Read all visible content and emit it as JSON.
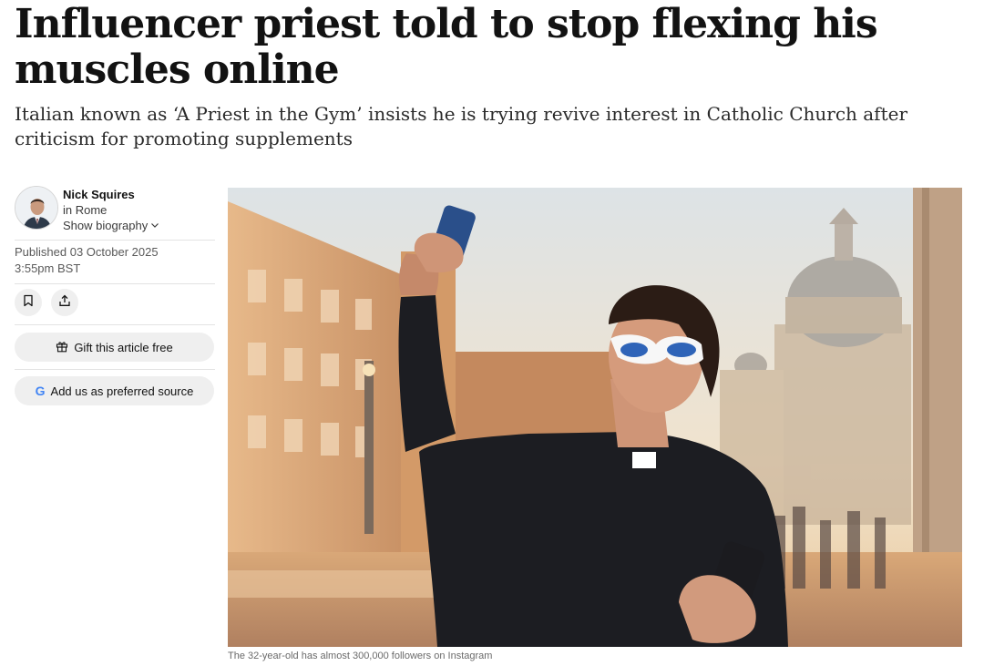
{
  "article": {
    "headline": "Influencer priest told to stop flexing his muscles online",
    "standfirst": "Italian known as ‘A Priest in the Gym’ insists he is trying revive interest in Catholic Church after criticism for promoting supplements"
  },
  "author": {
    "name": "Nick Squires",
    "location": "in Rome",
    "bio_toggle": "Show biography"
  },
  "published": {
    "date": "Published 03 October 2025",
    "time": "3:55pm BST"
  },
  "actions": {
    "gift_label": "Gift this article free",
    "preferred_source_label": "Add us as preferred source",
    "google_letter": "G"
  },
  "image": {
    "caption": "The 32-year-old has almost 300,000 followers on Instagram"
  },
  "icons": [
    "bookmark-icon",
    "share-icon",
    "gift-icon",
    "google-icon",
    "chevron-down-icon"
  ],
  "colors": {
    "text": "#121212",
    "muted": "#5a5a5a",
    "pill_bg": "#efefef",
    "google_blue": "#4285f4"
  }
}
